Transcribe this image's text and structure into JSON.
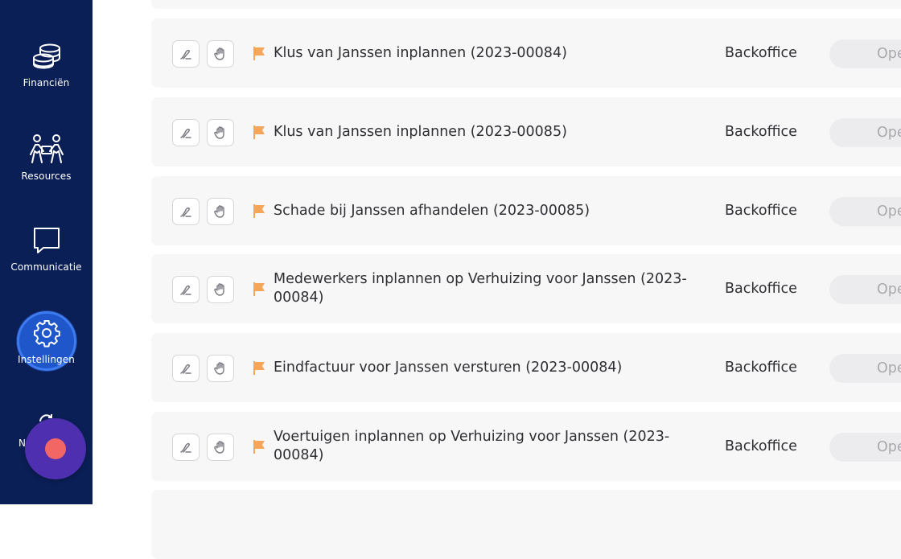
{
  "sidebar": {
    "items": [
      {
        "label": "Financiën",
        "icon": "coins-icon"
      },
      {
        "label": "Resources",
        "icon": "people-icon"
      },
      {
        "label": "Communicatie",
        "icon": "chat-icon"
      },
      {
        "label": "Instellingen",
        "icon": "gear-icon"
      },
      {
        "label": "N",
        "icon": "refresh-icon"
      }
    ]
  },
  "colors": {
    "sidebar_bg": "#0b1f57",
    "flag": "#f5a65b",
    "record_button": "#4d2fb0",
    "record_dot": "#f26665",
    "focus_ring": "#1f56c9"
  },
  "tasks": [
    {
      "title": "Klus van Janssen inplannen (2023-00084)",
      "department": "Backoffice",
      "status": "Ope"
    },
    {
      "title": "Klus van Janssen inplannen (2023-00085)",
      "department": "Backoffice",
      "status": "Ope"
    },
    {
      "title": "Schade bij Janssen afhandelen (2023-00085)",
      "department": "Backoffice",
      "status": "Ope"
    },
    {
      "title_line1": "Medewerkers inplannen op Verhuizing voor Janssen (2023-",
      "title_line2": "00084)",
      "department": "Backoffice",
      "status": "Ope"
    },
    {
      "title": "Eindfactuur voor Janssen versturen (2023-00084)",
      "department": "Backoffice",
      "status": "Ope"
    },
    {
      "title_line1": "Voertuigen inplannen op Verhuizing voor Janssen (2023-",
      "title_line2": "00084)",
      "department": "Backoffice",
      "status": "Ope"
    }
  ]
}
